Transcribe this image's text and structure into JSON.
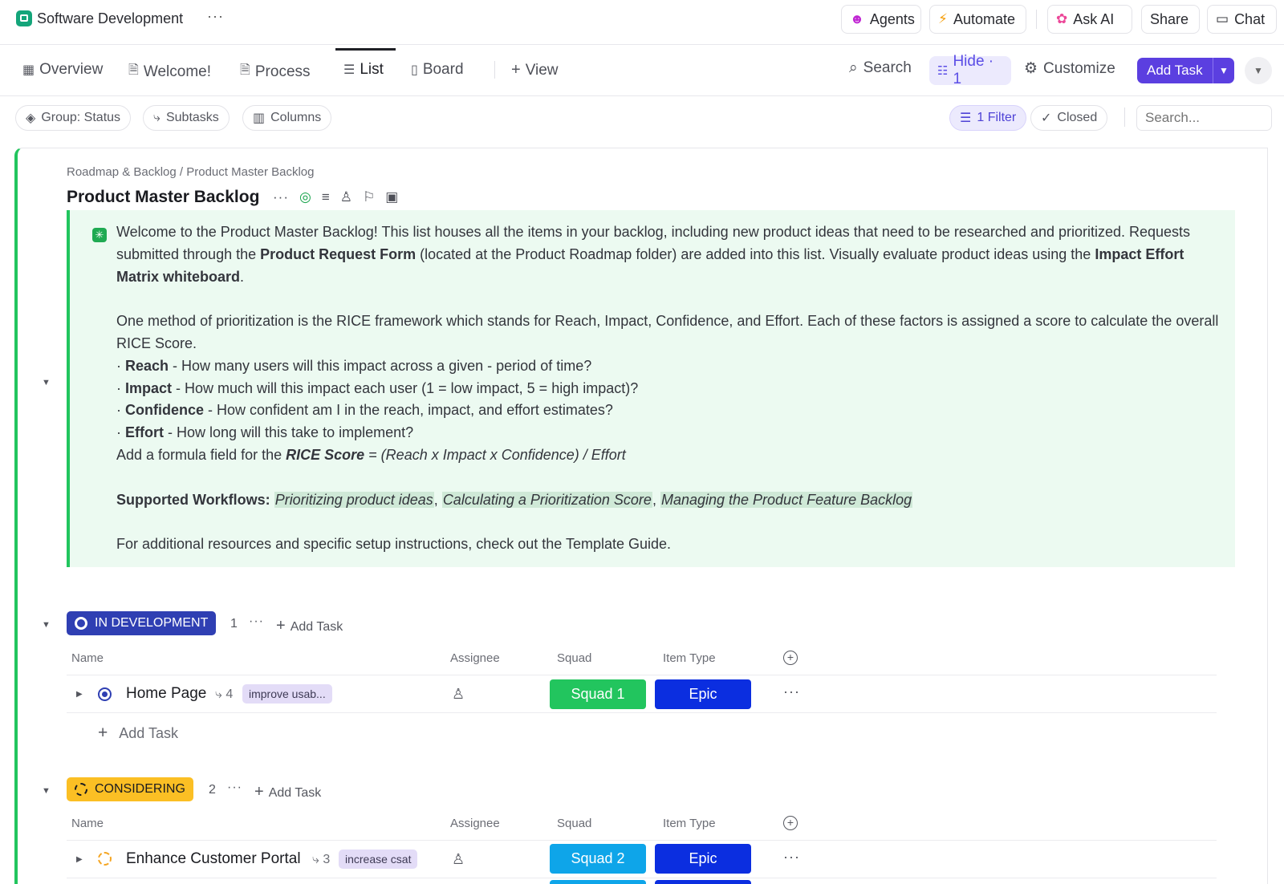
{
  "workspace": {
    "title": "Software Development"
  },
  "topbar": {
    "agents": "Agents",
    "automate": "Automate",
    "ask_ai": "Ask AI",
    "share": "Share",
    "chat": "Chat"
  },
  "tabs": [
    {
      "label": "Overview",
      "icon": "grid-icon"
    },
    {
      "label": "Welcome!",
      "icon": "doc-icon"
    },
    {
      "label": "Process",
      "icon": "doc-icon"
    },
    {
      "label": "List",
      "icon": "list-icon"
    },
    {
      "label": "Board",
      "icon": "board-icon"
    },
    {
      "label": "View",
      "icon": "plus-icon"
    }
  ],
  "toolbar": {
    "search": "Search",
    "hide": "Hide · 1",
    "customize": "Customize",
    "add_task": "Add Task"
  },
  "filters": {
    "group": "Group: Status",
    "subtasks": "Subtasks",
    "columns": "Columns",
    "filter": "1 Filter",
    "closed": "Closed",
    "search_placeholder": "Search..."
  },
  "list": {
    "breadcrumb": "Roadmap & Backlog / Product Master Backlog",
    "title": "Product Master Backlog"
  },
  "description": {
    "p1_a": "Welcome to the Product Master Backlog! This list houses all the items in your backlog, including new product ideas that need to be researched and prioritized. Requests submitted through the ",
    "p1_b": "Product Request Form",
    "p1_c": " (located at the Product Roadmap folder) are added into this list. Visually evaluate product ideas using the ",
    "p1_d": "Impact Effort Matrix whiteboard",
    "p1_e": ".",
    "p2": "One method of prioritization is the RICE framework which stands for Reach, Impact, Confidence, and Effort. Each of these factors is assigned a score to calculate the overall RICE Score.",
    "b1_k": "Reach",
    "b1_v": " - How many users will this impact across a given - period of time?",
    "b2_k": "Impact",
    "b2_v": " - How much will this impact each user (1 = low impact, 5 = high impact)?",
    "b3_k": "Confidence",
    "b3_v": " - How confident am I in the reach, impact, and effort estimates?",
    "b4_k": "Effort",
    "b4_v": " - How long will this take to implement?",
    "formula_a": "Add a formula field for the ",
    "formula_b": "RICE Score",
    "formula_c": " = (Reach x Impact x Confidence) / Effort",
    "workflows_label": "Supported Workflows:",
    "wf1": "Prioritizing product ideas",
    "wf2": "Calculating a Prioritization Score",
    "wf3": "Managing the Product Feature Backlog",
    "closing": "For additional resources and specific setup instructions, check out the Template Guide."
  },
  "columns": {
    "name": "Name",
    "assignee": "Assignee",
    "squad": "Squad",
    "item_type": "Item Type"
  },
  "groups": [
    {
      "status": "IN DEVELOPMENT",
      "count": "1",
      "add_task": "Add Task",
      "color": "#2f3fb3",
      "tasks": [
        {
          "name": "Home Page",
          "subtasks": "4",
          "tag": "improve usab...",
          "squad": "Squad 1",
          "squad_color": "#22c55e",
          "item_type": "Epic",
          "type_color": "#0b2ee0"
        }
      ],
      "add_row": "Add Task"
    },
    {
      "status": "CONSIDERING",
      "count": "2",
      "add_task": "Add Task",
      "color": "#fbbf24",
      "tasks": [
        {
          "name": "Enhance Customer Portal",
          "subtasks": "3",
          "tag": "increase csat",
          "squad": "Squad 2",
          "squad_color": "#0ea5e9",
          "item_type": "Epic",
          "type_color": "#0b2ee0"
        }
      ]
    }
  ]
}
